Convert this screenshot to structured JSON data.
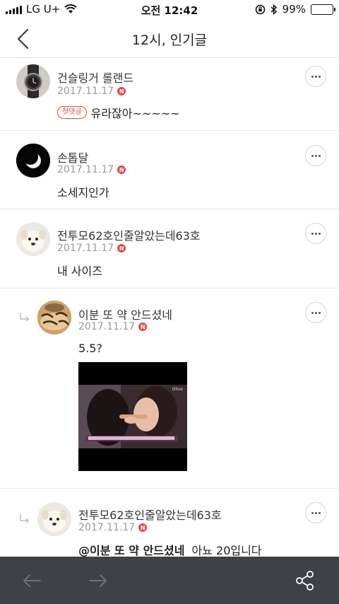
{
  "status_bar": {
    "carrier": "LG U+",
    "time": "오전 12:42",
    "battery": "99%",
    "battery_level": 0.99
  },
  "header": {
    "title": "12시, 인기글"
  },
  "comments": [
    {
      "author": "건슬링거 롤랜드",
      "date": "2017.11.17",
      "new_badge": "N",
      "first_badge": "첫댓글",
      "text": "유라잖아~~~~~",
      "is_reply": false,
      "avatar_icon": "watch-avatar"
    },
    {
      "author": "손톱달",
      "date": "2017.11.17",
      "new_badge": "N",
      "text": "소세지인가",
      "is_reply": false,
      "avatar_icon": "crescent-moon-avatar"
    },
    {
      "author": "전투모62호인줄알았는데63호",
      "date": "2017.11.17",
      "new_badge": "N",
      "text": "내 사이즈",
      "is_reply": false,
      "avatar_icon": "puppy-avatar"
    },
    {
      "author": "이분 또 약 안드셨네",
      "date": "2017.11.17",
      "new_badge": "N",
      "text": "5.5?",
      "is_reply": true,
      "avatar_icon": "tiger-avatar",
      "image_caption": "Olive"
    },
    {
      "author": "전투모62호인줄알았는데63호",
      "date": "2017.11.17",
      "new_badge": "N",
      "mention": "@이분 또 약 안드셨네",
      "text": "아뇨 20입니다",
      "is_reply": true,
      "avatar_icon": "puppy-avatar"
    }
  ],
  "bottom_bar": {
    "back_icon": "arrow-left-icon",
    "forward_icon": "arrow-right-icon",
    "share_icon": "share-icon",
    "background": "#3f4144"
  },
  "colors": {
    "accent_red": "#e84747",
    "divider": "#e8e8e8"
  }
}
